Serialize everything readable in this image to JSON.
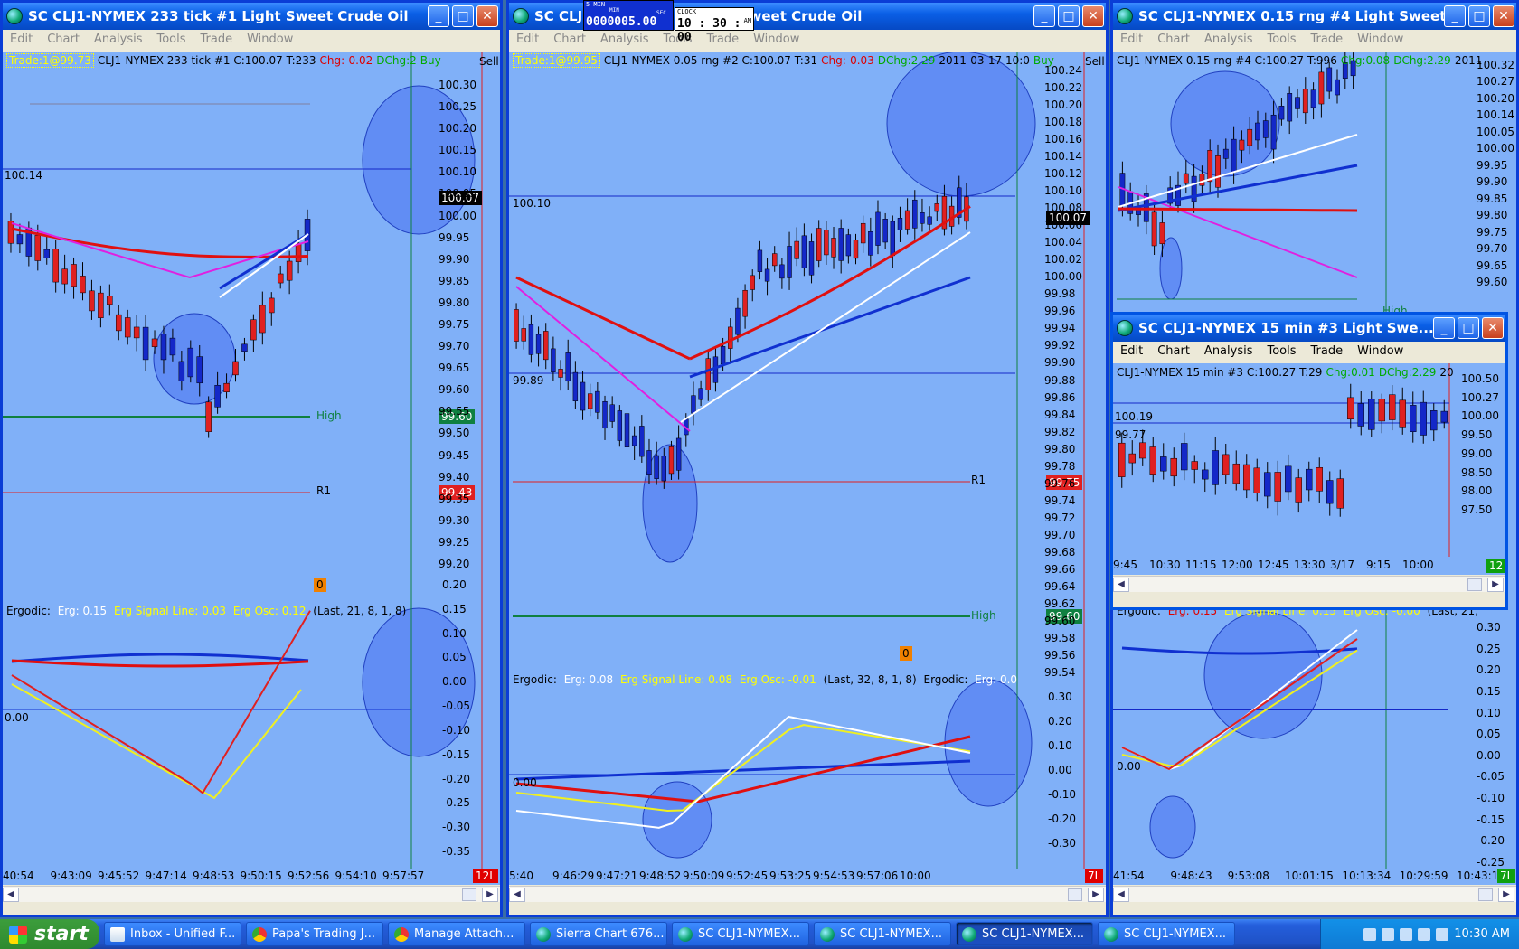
{
  "windows": [
    {
      "id": "w1",
      "title": "SC CLJ1-NYMEX  233 tick  #1  Light Sweet Crude Oil",
      "menu": [
        "Edit",
        "Chart",
        "Analysis",
        "Tools",
        "Trade",
        "Window"
      ],
      "header": {
        "trade": "Trade:1@99.73",
        "symbol": "CLJ1-NYMEX  233 tick  #1  C:100.07  T:233",
        "chg": "Chg:-0.02",
        "dchg": "DChg:2",
        "buy": "Buy",
        "sell": "Sell"
      },
      "price_ticks": [
        "100.30",
        "100.25",
        "100.20",
        "100.15",
        "100.10",
        "100.05",
        "100.00",
        "99.95",
        "99.90",
        "99.85",
        "99.80",
        "99.75",
        "99.70",
        "99.65",
        "99.60",
        "99.55",
        "99.50",
        "99.45",
        "99.40",
        "99.35",
        "99.30",
        "99.25",
        "99.20"
      ],
      "osc_ticks": [
        "0.20",
        "0.15",
        "0.10",
        "0.05",
        "0.00",
        "-0.05",
        "-0.10",
        "-0.15",
        "-0.20",
        "-0.25",
        "-0.30",
        "-0.35"
      ],
      "last_price": "100.07",
      "high_val": "99.60",
      "r1_val": "99.43",
      "line_label_left": "100.14",
      "high_label": "High",
      "r1_label": "R1",
      "zero_badge": "0",
      "osc_zero": "0.00",
      "osc_header": {
        "name": "Ergodic:",
        "erg": "Erg: 0.15",
        "signal": "Erg Signal Line: 0.03",
        "osc": "Erg Osc: 0.12",
        "params": "(Last, 21, 8, 1, 8)"
      },
      "time_ticks": [
        "40:54",
        "9:43:09",
        "9:45:52",
        "9:47:14",
        "9:48:53",
        "9:50:15",
        "9:52:56",
        "9:54:10",
        "9:57:57"
      ],
      "corner_badge": "12L"
    },
    {
      "id": "w2",
      "title_left": "SC CLJ1",
      "title_right": "ht Sweet Crude Oil",
      "menu": [
        "Edit",
        "Chart",
        "Analysis",
        "Tools",
        "Trade",
        "Window"
      ],
      "header": {
        "trade": "Trade:1@99.95",
        "symbol": "CLJ1-NYMEX  0.05 rng  #2  C:100.07  T:31",
        "chg": "Chg:-0.03",
        "dchg": "DChg:2.29",
        "date": "2011-03-17  10:0",
        "buy": "Buy",
        "sell": "Sell"
      },
      "price_ticks": [
        "100.24",
        "100.22",
        "100.20",
        "100.18",
        "100.16",
        "100.14",
        "100.12",
        "100.10",
        "100.08",
        "100.06",
        "100.04",
        "100.02",
        "100.00",
        "99.98",
        "99.96",
        "99.94",
        "99.92",
        "99.90",
        "99.88",
        "99.86",
        "99.84",
        "99.82",
        "99.80",
        "99.78",
        "99.76",
        "99.74",
        "99.72",
        "99.70",
        "99.68",
        "99.66",
        "99.64",
        "99.62",
        "99.60",
        "99.58",
        "99.56",
        "99.54"
      ],
      "osc_ticks": [
        "0.30",
        "0.20",
        "0.10",
        "0.00",
        "-0.10",
        "-0.20",
        "-0.30"
      ],
      "last_price": "100.07",
      "r1_val": "99.75",
      "high_val": "99.60",
      "line_label_top": "100.10",
      "line_label_mid": "99.89",
      "high_label": "High",
      "r1_label": "R1",
      "zero_badge": "0",
      "osc_zero": "0.00",
      "osc_header": {
        "name": "Ergodic:",
        "erg": "Erg: 0.08",
        "signal": "Erg Signal Line: 0.08",
        "osc": "Erg Osc: -0.01",
        "params": "(Last, 32, 8, 1, 8)",
        "name2": "Ergodic:",
        "erg2": "Erg: 0.0"
      },
      "time_ticks": [
        "5:40",
        "9:46:29",
        "9:47:21",
        "9:48:52",
        "9:50:09",
        "9:52:45",
        "9:53:25",
        "9:54:53",
        "9:57:06",
        "10:00"
      ],
      "corner_badge": "7L"
    },
    {
      "id": "w4",
      "title": "SC CLJ1-NYMEX  0.15 rng  #4  Light Sweet ...",
      "menu": [
        "Edit",
        "Chart",
        "Analysis",
        "Tools",
        "Trade",
        "Window"
      ],
      "header": {
        "symbol": "CLJ1-NYMEX  0.15 rng  #4  C:100.27  T:996",
        "chg": "Chg:0.08",
        "dchg": "DChg:2.29",
        "date": "2011"
      },
      "price_ticks": [
        "100.32",
        "100.27",
        "100.20",
        "100.14",
        "100.05",
        "100.00",
        "99.95",
        "99.90",
        "99.85",
        "99.80",
        "99.75",
        "99.70",
        "99.65",
        "99.60"
      ],
      "osc_ticks": [
        "0.30",
        "0.25",
        "0.20",
        "0.15",
        "0.10",
        "0.05",
        "0.00",
        "-0.05",
        "-0.10",
        "-0.15",
        "-0.20",
        "-0.25"
      ],
      "osc_header": {
        "name": "Ergodic:",
        "erg": "Erg: 0.15",
        "signal": "Erg Signal Line: 0.15",
        "osc": "Erg Osc: -0.00",
        "params": "(Last, 21,"
      },
      "high_label": "High",
      "osc_zero": "0.00",
      "time_ticks": [
        "41:54",
        "9:48:43",
        "9:53:08",
        "10:01:15",
        "10:13:34",
        "10:29:59",
        "10:43:14"
      ],
      "corner_badge": "7L"
    },
    {
      "id": "w3",
      "title": "SC CLJ1-NYMEX  15 min  #3  Light Swe...",
      "menu": [
        "Edit",
        "Chart",
        "Analysis",
        "Tools",
        "Trade",
        "Window"
      ],
      "header": {
        "symbol": "CLJ1-NYMEX  15 min  #3  C:100.27  T:29",
        "chg": "Chg:0.01",
        "dchg": "DChg:2.29",
        "tail": "20"
      },
      "price_ticks": [
        "100.50",
        "100.27",
        "100.00",
        "99.50",
        "99.00",
        "98.50",
        "98.00",
        "97.50"
      ],
      "line_label_top": "100.19",
      "line_label_mid": "99.77",
      "time_ticks": [
        "9:45",
        "10:30",
        "11:15",
        "12:00",
        "12:45",
        "13:30",
        "3/17",
        "9:15",
        "10:00"
      ],
      "corner_badge": "12"
    }
  ],
  "clock_widget": {
    "label_min": "MIN",
    "label_sec": "SEC",
    "label_top": "5 MIN",
    "counter": "0000005.00",
    "label_clock": "CLOCK",
    "time": "10 : 30 : 00",
    "ampm": "AM"
  },
  "taskbar": {
    "start": "start",
    "items": [
      {
        "label": "Inbox - Unified F...",
        "icon": "mail-icon"
      },
      {
        "label": "Papa's Trading J...",
        "icon": "chrome-icon"
      },
      {
        "label": "Manage Attach...",
        "icon": "chrome-icon"
      },
      {
        "label": "Sierra Chart 676...",
        "icon": "globe-icon"
      },
      {
        "label": "SC CLJ1-NYMEX...",
        "icon": "globe-icon"
      },
      {
        "label": "SC CLJ1-NYMEX...",
        "icon": "globe-icon"
      },
      {
        "label": "SC CLJ1-NYMEX...",
        "icon": "globe-icon",
        "active": true
      },
      {
        "label": "SC CLJ1-NYMEX...",
        "icon": "globe-icon"
      }
    ],
    "clock": "10:30 AM"
  },
  "colors": {
    "chart_bg": "#80b0f8",
    "bull": "#1428c8",
    "bear": "#e02020",
    "ema_red": "#e01010",
    "ema_blue": "#1030d0",
    "magenta": "#e020e0",
    "white": "#ffffff",
    "yellow": "#f0f020",
    "high": "#108040",
    "r1": "#e02020"
  }
}
